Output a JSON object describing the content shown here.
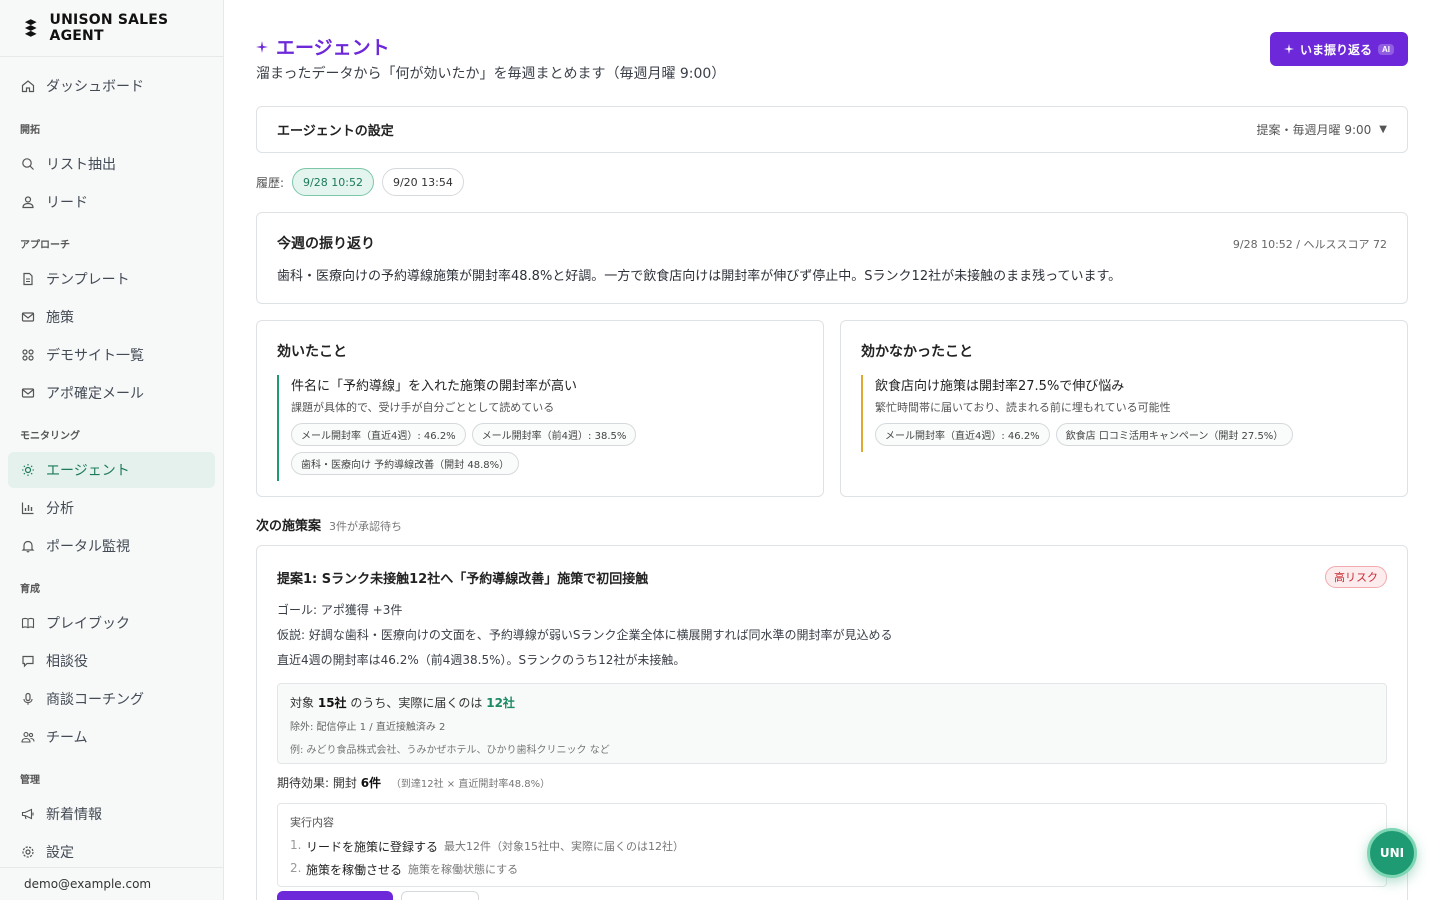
{
  "brand": {
    "name": "UNISON SALES AGENT"
  },
  "sidebar": {
    "dashboard": "ダッシュボード",
    "sections": [
      {
        "label": "開拓",
        "items": [
          "リスト抽出",
          "リード"
        ]
      },
      {
        "label": "アプローチ",
        "items": [
          "テンプレート",
          "施策",
          "デモサイト一覧",
          "アポ確定メール"
        ]
      },
      {
        "label": "モニタリング",
        "items": [
          "エージェント",
          "分析",
          "ポータル監視"
        ]
      },
      {
        "label": "育成",
        "items": [
          "プレイブック",
          "相談役",
          "商談コーチング",
          "チーム"
        ]
      },
      {
        "label": "管理",
        "items": [
          "新着情報",
          "設定"
        ]
      }
    ],
    "active": "エージェント",
    "footer_email": "demo@example.com"
  },
  "header": {
    "title": "エージェント",
    "subtitle": "溜まったデータから「何が効いたか」を毎週まとめます（毎週月曜 9:00）",
    "cta_label": "いま振り返る",
    "cta_badge": "AI"
  },
  "settings": {
    "title": "エージェントの設定",
    "meta": "提案・毎週月曜 9:00"
  },
  "history": {
    "label": "履歴:",
    "items": [
      "9/28 10:52",
      "9/20 13:54"
    ],
    "active_index": 0
  },
  "weekly": {
    "title": "今週の振り返り",
    "meta": "9/28 10:52 / ヘルススコア 72",
    "text": "歯科・医療向けの予約導線施策が開封率48.8%と好調。一方で飲食店向けは開封率が伸びず停止中。Sランク12社が未接触のまま残っています。"
  },
  "worked": {
    "title": "効いたこと",
    "item_title": "件名に「予約導線」を入れた施策の開封率が高い",
    "item_desc": "課題が具体的で、受け手が自分ごととして読めている",
    "tags": [
      "メール開封率（直近4週）: 46.2%",
      "メール開封率（前4週）: 38.5%",
      "歯科・医療向け 予約導線改善（開封 48.8%）"
    ]
  },
  "not_worked": {
    "title": "効かなかったこと",
    "item_title": "飲食店向け施策は開封率27.5%で伸び悩み",
    "item_desc": "繁忙時間帯に届いており、読まれる前に埋もれている可能性",
    "tags": [
      "メール開封率（直近4週）: 46.2%",
      "飲食店 口コミ活用キャンペーン（開封 27.5%）"
    ]
  },
  "next": {
    "title": "次の施策案",
    "count": "3件が承認待ち"
  },
  "proposal": {
    "title": "提案1: Sランク未接触12社へ「予約導線改善」施策で初回接触",
    "risk": "高リスク",
    "goal": "ゴール: アポ獲得 +3件",
    "hypothesis": "仮説: 好調な歯科・医療向けの文面を、予約導線が弱いSランク企業全体に横展開すれば同水準の開封率が見込める",
    "recent": "直近4週の開封率は46.2%（前4週38.5%）。Sランクのうち12社が未接触。",
    "target_prefix": "対象",
    "target_total": "15社",
    "target_mid": "のうち、実際に届くのは",
    "target_reach": "12社",
    "exclusions": "除外: 配信停止 1 / 直近接触済み 2",
    "examples": "例: みどり食品株式会社、うみかぜホテル、ひかり歯科クリニック など",
    "effect_label": "期待効果: 開封",
    "effect_value": "6件",
    "effect_note": "（到達12社 × 直近開封率48.8%）",
    "exec_label": "実行内容",
    "steps": [
      {
        "num": "1.",
        "action": "リードを施策に登録する",
        "detail": "最大12件（対象15社中、実際に届くのは12社）"
      },
      {
        "num": "2.",
        "action": "施策を稼働させる",
        "detail": "施策を稼働状態にする"
      }
    ]
  },
  "fab": {
    "label": "UNI"
  },
  "colors": {
    "accent": "#6d28d9",
    "green": "#1f9b73",
    "amber": "#e0a82e",
    "risk": "#c92a35"
  }
}
